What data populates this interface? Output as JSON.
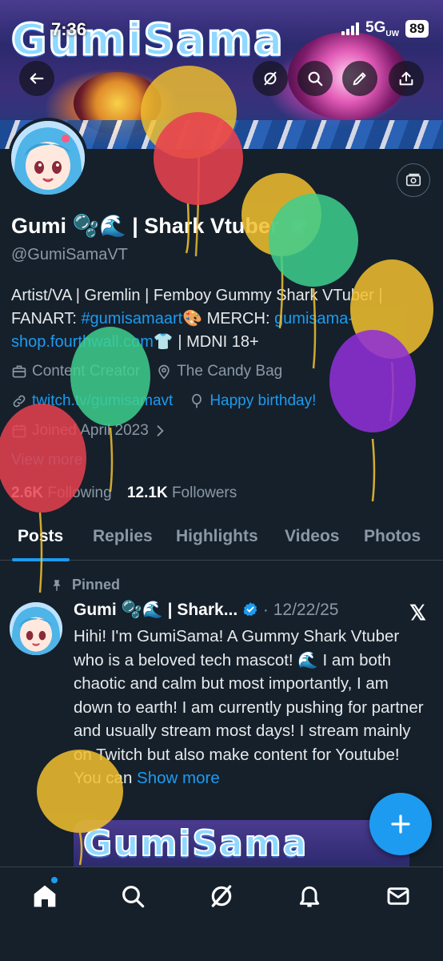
{
  "status_bar": {
    "time": "7:36",
    "network": "5G",
    "network_sub": "UW",
    "battery": "89"
  },
  "banner": {
    "logo_text": "GumiSama"
  },
  "profile": {
    "display_name": "Gumi 🫧🌊 | Shark Vtuber",
    "handle": "@GumiSamaVT",
    "bio": {
      "part1": "Artist/VA | Gremlin | Femboy Gummy Shark VTuber | FANART: ",
      "hashtag": "#gumisamaart",
      "part2": "🎨 MERCH: ",
      "shop_link": "gumisama-shop.fourthwall.com",
      "part3": "👕 | MDNI 18+"
    },
    "category": "Content Creator",
    "location": "The Candy Bag",
    "website": "twitch.tv/gumisamavt",
    "birthday": "Happy birthday!",
    "joined": "Joined April 2023",
    "view_more": "View more",
    "following_count": "2.6K",
    "following_label": "Following",
    "followers_count": "12.1K",
    "followers_label": "Followers"
  },
  "tabs": [
    "Posts",
    "Replies",
    "Highlights",
    "Videos",
    "Photos"
  ],
  "post": {
    "pinned_label": "Pinned",
    "author": "Gumi 🫧🌊 | Shark...",
    "date": "· 12/22/25",
    "text": "Hihi! I'm GumiSama! A Gummy Shark Vtuber who is a beloved tech mascot! 🌊 I am both chaotic and calm but most importantly, I am down to earth! I am currently pushing for partner and usually stream most days! I stream mainly on Twitch but also make content for Youtube! You can ",
    "show_more": "Show more",
    "media_logo": "GumiSama",
    "x_badge": "𝕏"
  },
  "colors": {
    "background": "#15202b",
    "accent": "#1d9bf0",
    "muted_text": "#8b98a5",
    "balloon_yellow": "#f2c12e",
    "balloon_red": "#e8414f",
    "balloon_green": "#3ecf8e",
    "balloon_purple": "#8e2fd6"
  },
  "icons": {
    "header": [
      "back-arrow-icon",
      "grok-icon",
      "search-icon",
      "edit-icon",
      "share-icon"
    ],
    "money": "money-icon",
    "nav": [
      "home-icon",
      "search-icon",
      "grok-icon",
      "bell-icon",
      "mail-icon"
    ],
    "fab": "plus-icon"
  }
}
